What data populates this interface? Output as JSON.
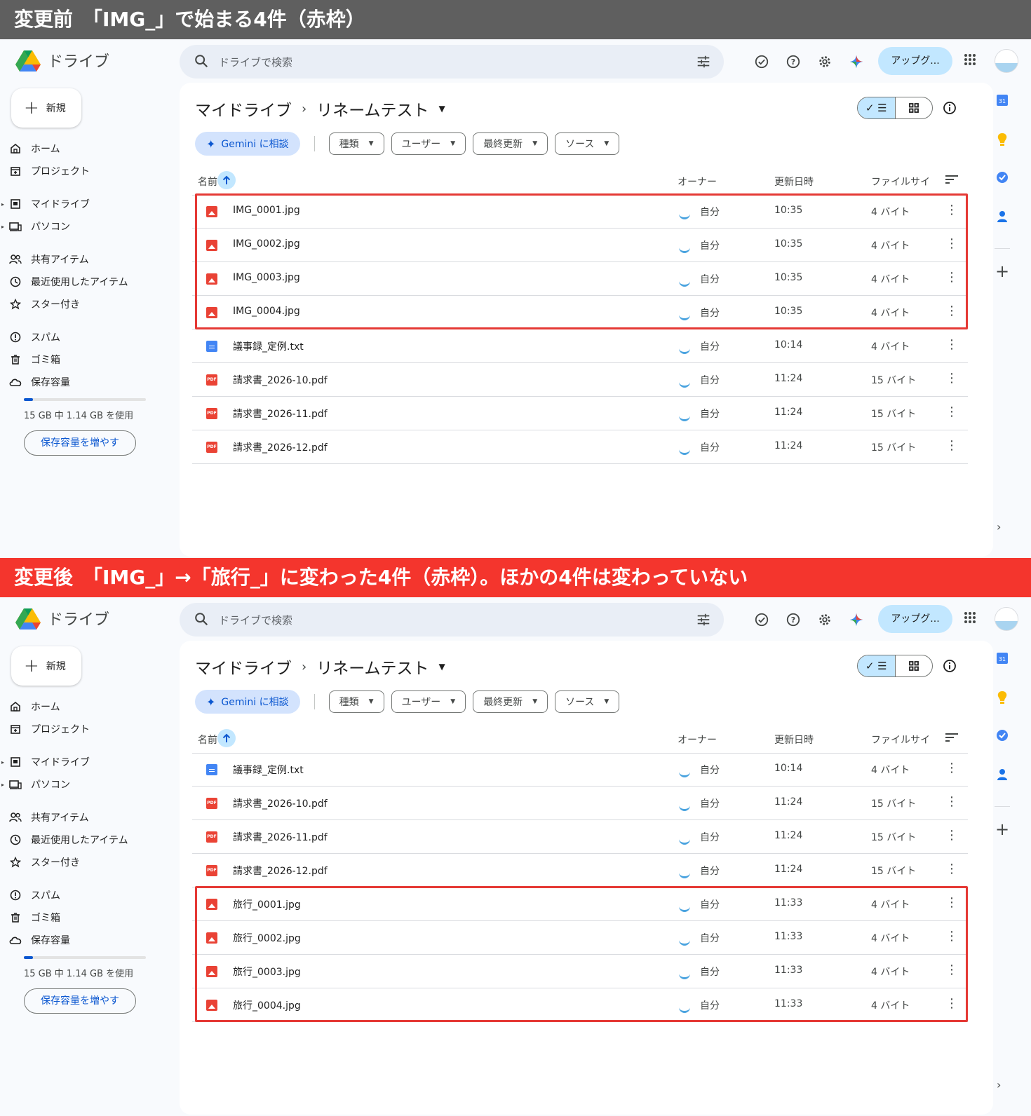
{
  "banners": {
    "before": "変更前　「IMG_」で始まる4件（赤枠）",
    "after": "変更後　「IMG_」→「旅行_」に変わった4件（赤枠）。ほかの4件は変わっていない"
  },
  "app": {
    "name": "ドライブ",
    "search_placeholder": "ドライブで検索",
    "upgrade_label": "アップグ...",
    "new_label": "新規",
    "nav": {
      "home": "ホーム",
      "projects": "プロジェクト",
      "my_drive": "マイドライブ",
      "computers": "パソコン",
      "shared": "共有アイテム",
      "recent": "最近使用したアイテム",
      "starred": "スター付き",
      "spam": "スパム",
      "trash": "ゴミ箱",
      "storage": "保存容量"
    },
    "storage_text": "15 GB 中 1.14 GB を使用",
    "storage_used_fraction": 0.076,
    "storage_button": "保存容量を増やす",
    "breadcrumb": {
      "root": "マイドライブ",
      "folder": "リネームテスト"
    },
    "chips": {
      "gemini": "Gemini に相談",
      "type": "種類",
      "user": "ユーザー",
      "modified": "最終更新",
      "source": "ソース"
    },
    "columns": {
      "name": "名前",
      "owner": "オーナー",
      "modified": "更新日時",
      "size": "ファイルサイ"
    },
    "rail_calendar": "31"
  },
  "before": {
    "files": [
      {
        "name": "IMG_0001.jpg",
        "type": "image",
        "owner": "自分",
        "modified": "10:35",
        "size": "4 バイト"
      },
      {
        "name": "IMG_0002.jpg",
        "type": "image",
        "owner": "自分",
        "modified": "10:35",
        "size": "4 バイト"
      },
      {
        "name": "IMG_0003.jpg",
        "type": "image",
        "owner": "自分",
        "modified": "10:35",
        "size": "4 バイト"
      },
      {
        "name": "IMG_0004.jpg",
        "type": "image",
        "owner": "自分",
        "modified": "10:35",
        "size": "4 バイト"
      },
      {
        "name": "議事録_定例.txt",
        "type": "text",
        "owner": "自分",
        "modified": "10:14",
        "size": "4 バイト"
      },
      {
        "name": "請求書_2026-10.pdf",
        "type": "pdf",
        "owner": "自分",
        "modified": "11:24",
        "size": "15 バイト"
      },
      {
        "name": "請求書_2026-11.pdf",
        "type": "pdf",
        "owner": "自分",
        "modified": "11:24",
        "size": "15 バイト"
      },
      {
        "name": "請求書_2026-12.pdf",
        "type": "pdf",
        "owner": "自分",
        "modified": "11:24",
        "size": "15 バイト"
      }
    ],
    "highlight": {
      "from": 0,
      "count": 4
    }
  },
  "after": {
    "files": [
      {
        "name": "議事録_定例.txt",
        "type": "text",
        "owner": "自分",
        "modified": "10:14",
        "size": "4 バイト"
      },
      {
        "name": "請求書_2026-10.pdf",
        "type": "pdf",
        "owner": "自分",
        "modified": "11:24",
        "size": "15 バイト"
      },
      {
        "name": "請求書_2026-11.pdf",
        "type": "pdf",
        "owner": "自分",
        "modified": "11:24",
        "size": "15 バイト"
      },
      {
        "name": "請求書_2026-12.pdf",
        "type": "pdf",
        "owner": "自分",
        "modified": "11:24",
        "size": "15 バイト"
      },
      {
        "name": "旅行_0001.jpg",
        "type": "image",
        "owner": "自分",
        "modified": "11:33",
        "size": "4 バイト"
      },
      {
        "name": "旅行_0002.jpg",
        "type": "image",
        "owner": "自分",
        "modified": "11:33",
        "size": "4 バイト"
      },
      {
        "name": "旅行_0003.jpg",
        "type": "image",
        "owner": "自分",
        "modified": "11:33",
        "size": "4 バイト"
      },
      {
        "name": "旅行_0004.jpg",
        "type": "image",
        "owner": "自分",
        "modified": "11:33",
        "size": "4 バイト"
      }
    ],
    "highlight": {
      "from": 4,
      "count": 4
    }
  },
  "colors": {
    "before_banner": "#5f5f5f",
    "after_banner": "#f4352d",
    "highlight_border": "#e53935",
    "accent": "#0b57d0"
  }
}
